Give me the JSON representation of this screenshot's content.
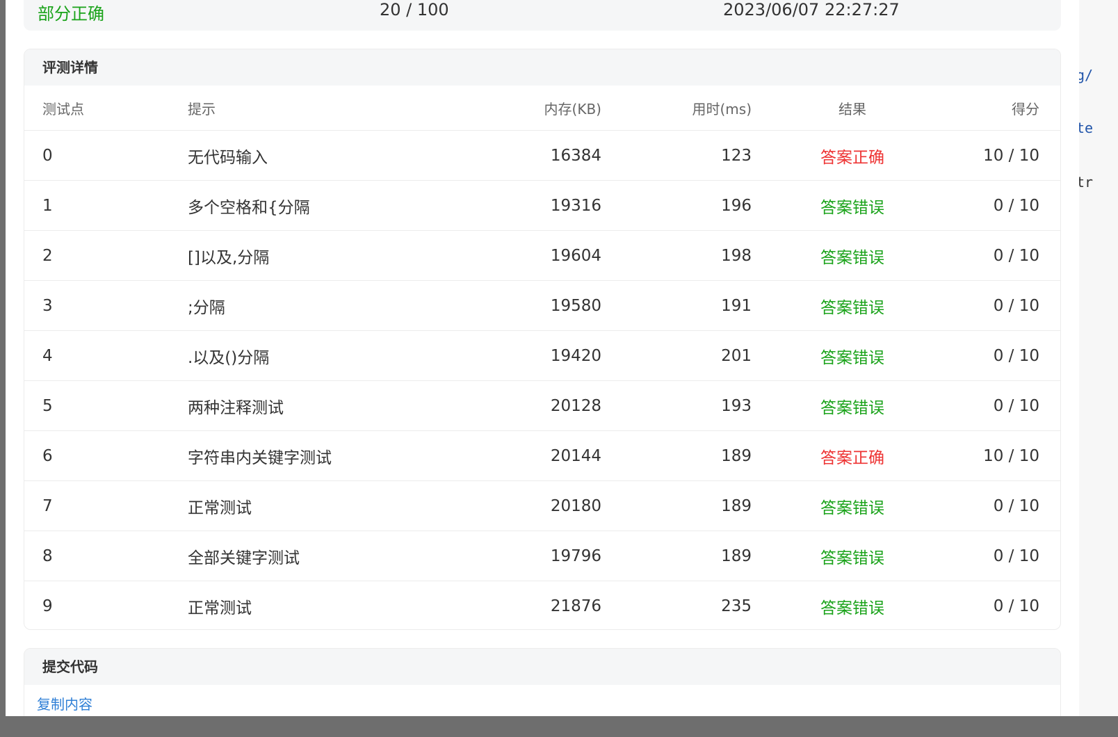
{
  "summary": {
    "status": "部分正确",
    "score": "20 / 100",
    "submitted_at": "2023/06/07 22:27:27"
  },
  "details": {
    "title": "评测详情",
    "columns": {
      "id": "测试点",
      "hint": "提示",
      "memory": "内存(KB)",
      "time": "用时(ms)",
      "result": "结果",
      "score": "得分"
    },
    "rows": [
      {
        "id": "0",
        "hint": "无代码输入",
        "memory": "16384",
        "time": "123",
        "result": "答案正确",
        "score": "10 / 10"
      },
      {
        "id": "1",
        "hint": "多个空格和{分隔",
        "memory": "19316",
        "time": "196",
        "result": "答案错误",
        "score": "0 / 10"
      },
      {
        "id": "2",
        "hint": "[]以及,分隔",
        "memory": "19604",
        "time": "198",
        "result": "答案错误",
        "score": "0 / 10"
      },
      {
        "id": "3",
        "hint": ";分隔",
        "memory": "19580",
        "time": "191",
        "result": "答案错误",
        "score": "0 / 10"
      },
      {
        "id": "4",
        "hint": ".以及()分隔",
        "memory": "19420",
        "time": "201",
        "result": "答案错误",
        "score": "0 / 10"
      },
      {
        "id": "5",
        "hint": "两种注释测试",
        "memory": "20128",
        "time": "193",
        "result": "答案错误",
        "score": "0 / 10"
      },
      {
        "id": "6",
        "hint": "字符串内关键字测试",
        "memory": "20144",
        "time": "189",
        "result": "答案正确",
        "score": "10 / 10"
      },
      {
        "id": "7",
        "hint": "正常测试",
        "memory": "20180",
        "time": "189",
        "result": "答案错误",
        "score": "0 / 10"
      },
      {
        "id": "8",
        "hint": "全部关键字测试",
        "memory": "19796",
        "time": "189",
        "result": "答案错误",
        "score": "0 / 10"
      },
      {
        "id": "9",
        "hint": "正常测试",
        "memory": "21876",
        "time": "235",
        "result": "答案错误",
        "score": "0 / 10"
      }
    ]
  },
  "code": {
    "title": "提交代码",
    "copy_label": "复制内容"
  },
  "background_fragments": [
    "g/",
    "te",
    "tr"
  ],
  "colors": {
    "accepted": "#ee3333",
    "wrong": "#1aa31a",
    "link": "#2f7fd6",
    "header_bg": "#f5f6f7"
  }
}
